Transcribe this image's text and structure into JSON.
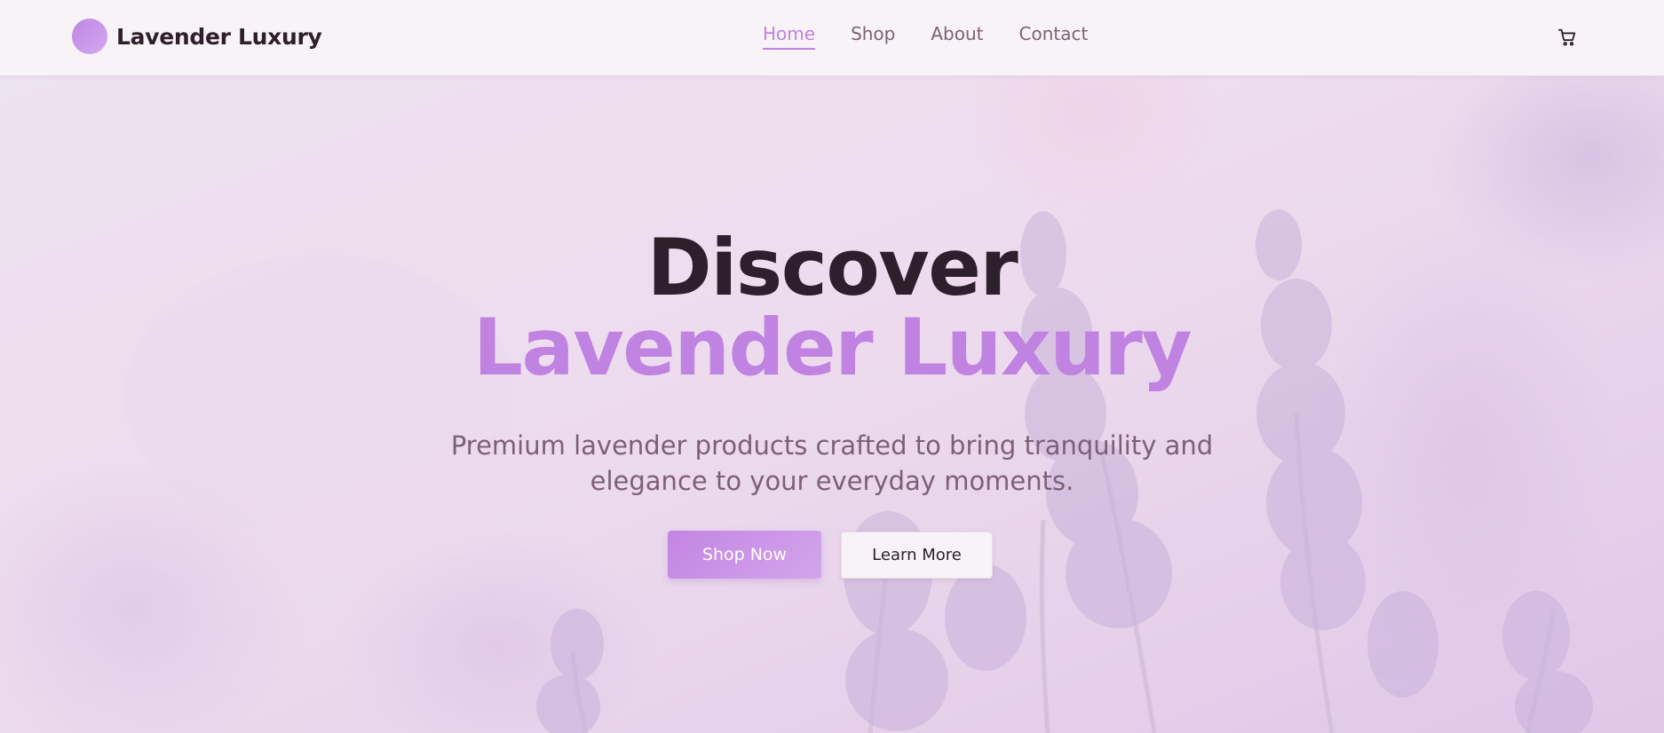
{
  "header": {
    "brand_name": "Lavender Luxury",
    "logo_icon": "lavender-circle-logo",
    "nav": [
      {
        "label": "Home",
        "active": true
      },
      {
        "label": "Shop",
        "active": false
      },
      {
        "label": "About",
        "active": false
      },
      {
        "label": "Contact",
        "active": false
      }
    ],
    "cart_icon": "shopping-cart-icon"
  },
  "hero": {
    "title_line1": "Discover",
    "title_line2": "Lavender Luxury",
    "subtitle_line1": "Premium lavender products crafted to bring tranquility and",
    "subtitle_line2": "elegance to your everyday moments.",
    "primary_button": "Shop Now",
    "secondary_button": "Learn More"
  },
  "colors": {
    "accent": "#c183e2",
    "heading": "#2d1f2b",
    "muted_text": "#7d6078",
    "nav_text": "#7c6376",
    "header_bg": "#f8f3f6",
    "hero_overlay": "#f0dff0"
  }
}
